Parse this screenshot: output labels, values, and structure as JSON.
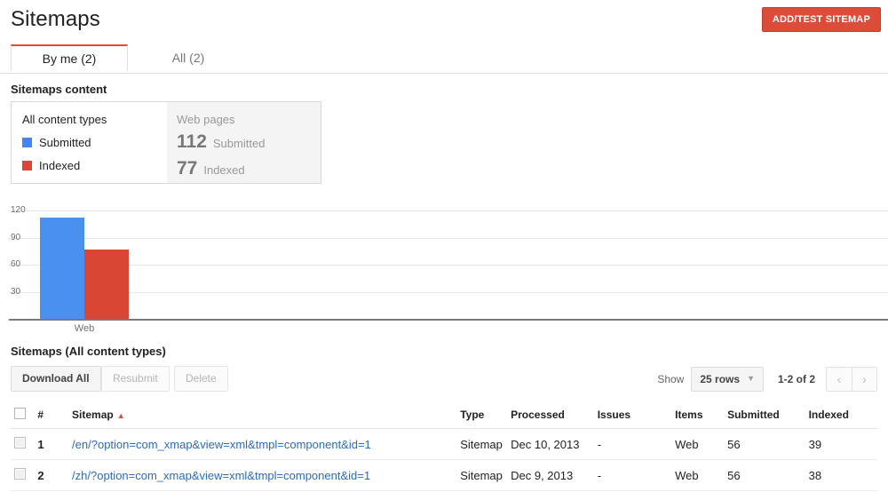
{
  "header": {
    "title": "Sitemaps",
    "add_button": "ADD/TEST SITEMAP",
    "accent_red": "#dd4b39"
  },
  "tabs": [
    {
      "label": "By me (2)",
      "active": true
    },
    {
      "label": "All (2)",
      "active": false
    }
  ],
  "sitemaps_content": {
    "section_label": "Sitemaps content",
    "all_types_card": {
      "title": "All content types",
      "legend": [
        {
          "label": "Submitted",
          "color": "#4285f4"
        },
        {
          "label": "Indexed",
          "color": "#db4437"
        }
      ]
    },
    "web_pages_card": {
      "title": "Web pages",
      "stats": [
        {
          "value": "112",
          "label": "Submitted"
        },
        {
          "value": "77",
          "label": "Indexed"
        }
      ]
    }
  },
  "chart_data": {
    "type": "bar",
    "title": "",
    "xlabel": "",
    "ylabel": "",
    "categories": [
      "Web"
    ],
    "series": [
      {
        "name": "Submitted",
        "values": [
          112
        ],
        "color": "#4a90f0"
      },
      {
        "name": "Indexed",
        "values": [
          77
        ],
        "color": "#d94634"
      }
    ],
    "yticks": [
      "120",
      "90",
      "60",
      "30"
    ],
    "ylim": [
      0,
      130
    ],
    "grid": true,
    "legend_position": "external-card"
  },
  "table_section": {
    "title": "Sitemaps (All content types)",
    "buttons": [
      {
        "label": "Download All",
        "disabled": false
      },
      {
        "label": "Resubmit",
        "disabled": true
      },
      {
        "label": "Delete",
        "disabled": true
      }
    ],
    "pager": {
      "show_label": "Show",
      "rows_value": "25 rows",
      "range": "1-2 of 2",
      "prev_icon": "chevron-left",
      "next_icon": "chevron-right"
    },
    "columns": [
      {
        "key": "check",
        "label": ""
      },
      {
        "key": "num",
        "label": "#",
        "muted": true
      },
      {
        "key": "sitemap",
        "label": "Sitemap",
        "sorted": true,
        "sort_dir": "asc"
      },
      {
        "key": "type",
        "label": "Type"
      },
      {
        "key": "processed",
        "label": "Processed"
      },
      {
        "key": "issues",
        "label": "Issues"
      },
      {
        "key": "items",
        "label": "Items",
        "muted": true
      },
      {
        "key": "submitted",
        "label": "Submitted",
        "muted": true
      },
      {
        "key": "indexed",
        "label": "Indexed",
        "muted": true
      }
    ],
    "rows": [
      {
        "num": "1",
        "sitemap": "/en/?option=com_xmap&view=xml&tmpl=component&id=1",
        "type": "Sitemap",
        "processed": "Dec 10, 2013",
        "issues": "-",
        "items": "Web",
        "submitted": "56",
        "indexed": "39"
      },
      {
        "num": "2",
        "sitemap": "/zh/?option=com_xmap&view=xml&tmpl=component&id=1",
        "type": "Sitemap",
        "processed": "Dec 9, 2013",
        "issues": "-",
        "items": "Web",
        "submitted": "56",
        "indexed": "38"
      }
    ]
  }
}
